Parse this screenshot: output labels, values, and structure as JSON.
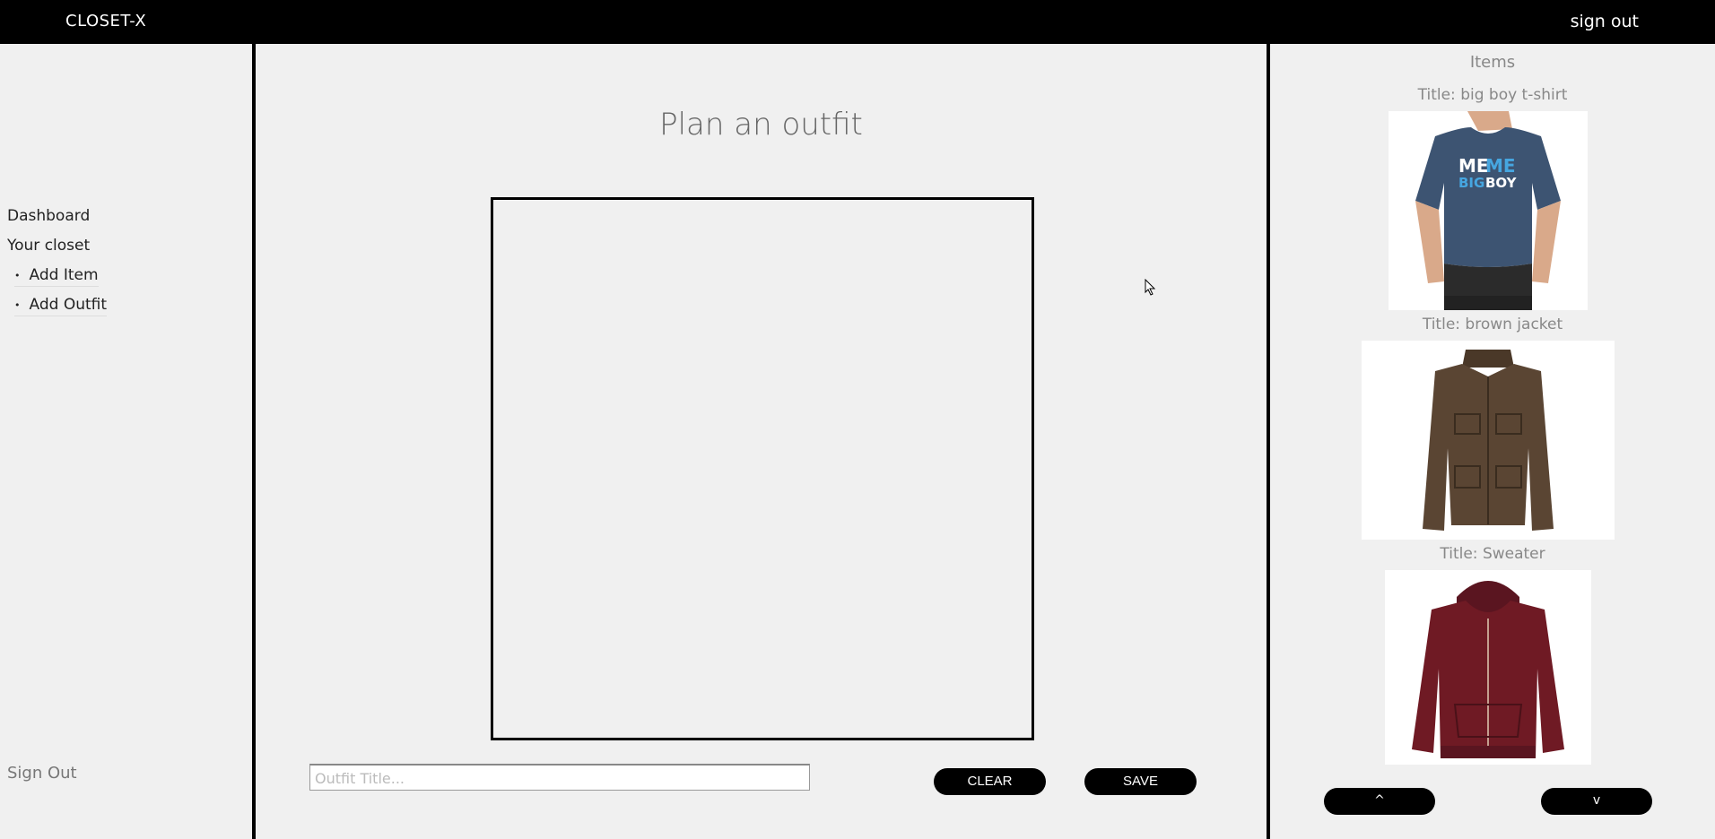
{
  "app": {
    "brand": "CLOSET-X",
    "top_signout": "sign out"
  },
  "sidebar": {
    "items": [
      {
        "label": "Dashboard"
      },
      {
        "label": "Your closet"
      },
      {
        "label": "Add Item",
        "bullet": "•"
      },
      {
        "label": "Add Outfit",
        "bullet": "•"
      }
    ],
    "signout": "Sign Out"
  },
  "main": {
    "title": "Plan an outfit",
    "input_placeholder": "Outfit Title...",
    "clear_label": "CLEAR",
    "save_label": "SAVE"
  },
  "items_panel": {
    "heading": "Items",
    "items": [
      {
        "title": "Title: big boy t-shirt",
        "shirt_text_1": "ME",
        "shirt_text_2": "ME",
        "shirt_text_3": "BIG",
        "shirt_text_4": "BOY"
      },
      {
        "title": "Title: brown jacket"
      },
      {
        "title": "Title: Sweater"
      }
    ],
    "up_label": "^",
    "down_label": "v"
  },
  "colors": {
    "topbar": "#000000",
    "background": "#f0f0f0",
    "tshirt": "#3d5472",
    "jacket": "#5a4533",
    "sweater": "#6f1a24"
  }
}
